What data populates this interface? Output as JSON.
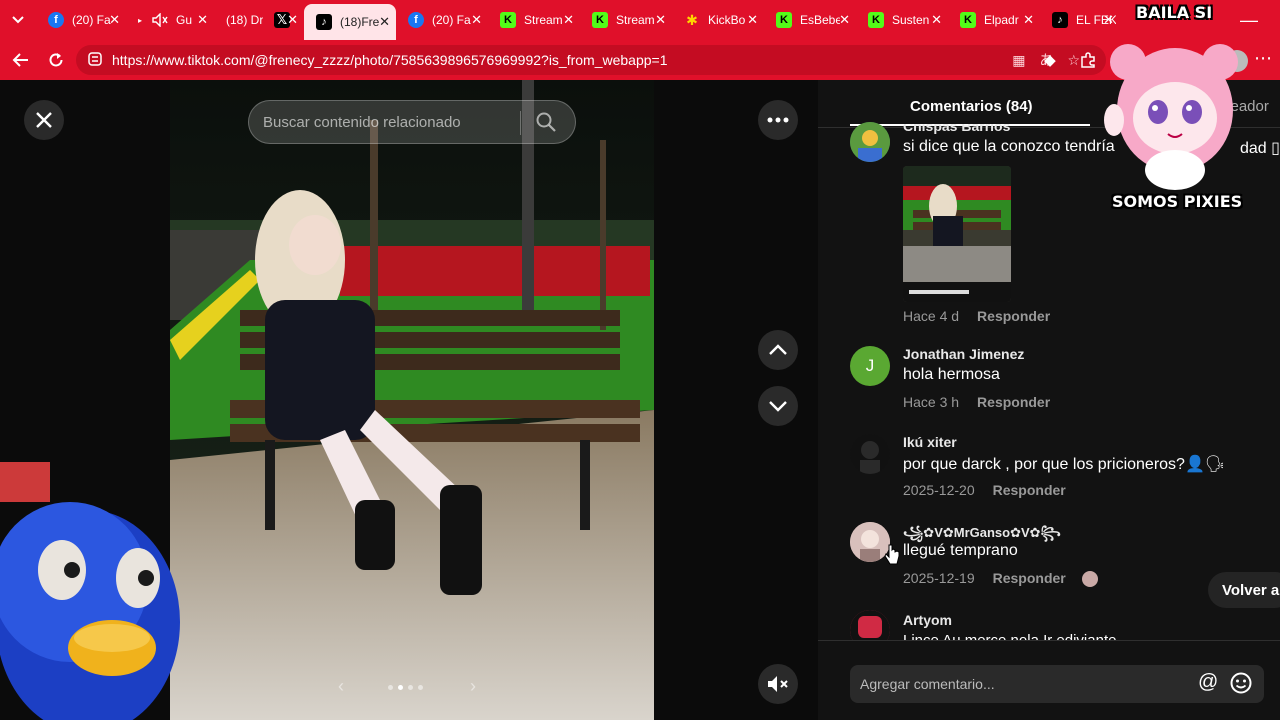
{
  "browser": {
    "tabs": [
      {
        "title": "(20) Fa",
        "favicon": "facebook-icon",
        "type": "fb"
      },
      {
        "title": "Gu",
        "favicon": "muted-speaker-icon",
        "type": "mute"
      },
      {
        "title": "(18) Dr",
        "favicon": "x-logo-icon",
        "type": "x"
      },
      {
        "title": "(18)Fre",
        "favicon": "tiktok-icon",
        "type": "tk",
        "active": true
      },
      {
        "title": "(20) Fa",
        "favicon": "facebook-icon",
        "type": "fb"
      },
      {
        "title": "Stream",
        "favicon": "kick-icon",
        "type": "kick"
      },
      {
        "title": "Stream",
        "favicon": "kick-icon",
        "type": "kick"
      },
      {
        "title": "KickBo",
        "favicon": "kickbot-icon",
        "type": "kb"
      },
      {
        "title": "EsBebe",
        "favicon": "kick-icon",
        "type": "kick"
      },
      {
        "title": "Susten",
        "favicon": "kick-icon",
        "type": "kick"
      },
      {
        "title": "Elpadr",
        "favicon": "kick-icon",
        "type": "kick"
      },
      {
        "title": "EL FEK",
        "favicon": "tiktok-icon",
        "type": "tk"
      }
    ],
    "url": "https://www.tiktok.com/@frenecy_zzzz/photo/7585639896576969992?is_from_webapp=1",
    "accent": "#e0102a"
  },
  "viewer": {
    "search_placeholder": "Buscar contenido relacionado"
  },
  "comments_panel": {
    "tab_comments": "Comentarios (84)",
    "tab_creator": "creador",
    "comments": [
      {
        "user": "Chispas Barrios",
        "text": "si dice que la conozco tendría",
        "text_suffix": "dad ▯",
        "time": "Hace 4 d",
        "reply": "Responder",
        "avatar_color": "#3a6",
        "avatar_letter": ""
      },
      {
        "user": "Jonathan Jimenez",
        "text": "hola hermosa",
        "time": "Hace 3 h",
        "reply": "Responder",
        "avatar_color": "#5aa832",
        "avatar_letter": "J"
      },
      {
        "user": "Ikú xiter",
        "text": "por que darck , por que los pricioneros?👤🗣",
        "time": "2025-12-20",
        "reply": "Responder",
        "avatar_color": "#1a1a1a",
        "avatar_letter": ""
      },
      {
        "user": "꧁✿V✿MrGanso✿V✿꧂",
        "text": "llegué temprano",
        "time": "2025-12-19",
        "reply": "Responder",
        "avatar_color": "#c9a9a6",
        "avatar_letter": ""
      },
      {
        "user": "Artyom",
        "text": "Lince Au merce nola Ir ediviante",
        "time": "",
        "reply": "",
        "avatar_color": "#c0304a",
        "avatar_letter": ""
      }
    ],
    "back_button": "Volver a",
    "composer_placeholder": "Agregar comentario..."
  },
  "overlay": {
    "sticker_top": "BAILA SI",
    "sticker_bottom": "SOMOS PIXIES"
  }
}
